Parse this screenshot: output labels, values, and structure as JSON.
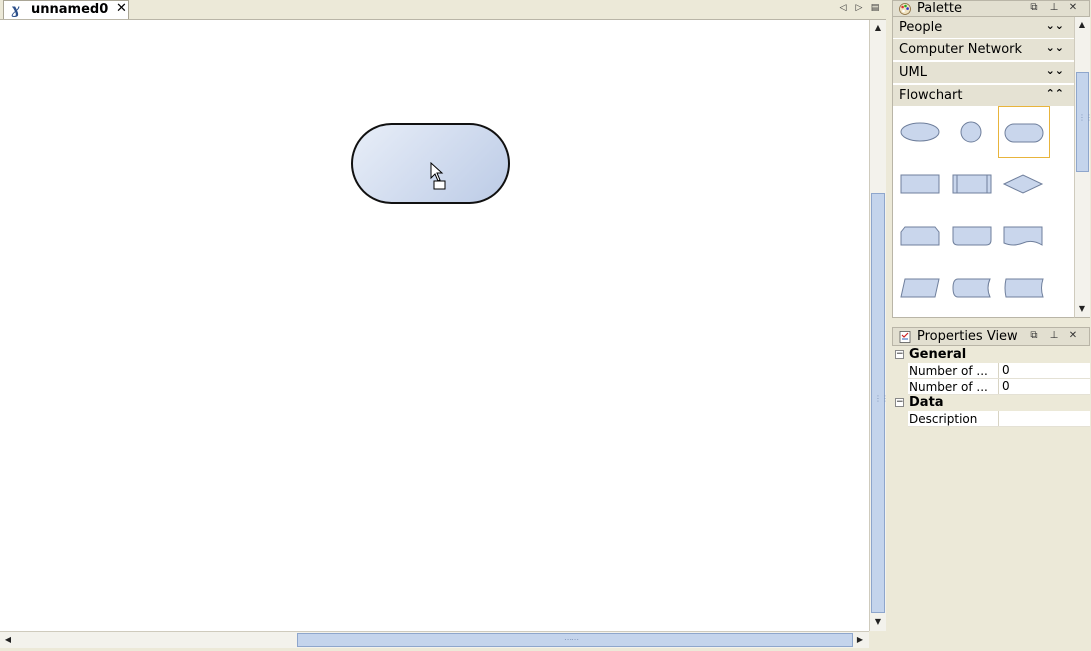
{
  "editor": {
    "tab_label": "unnamed0",
    "tab_close": "✕",
    "nav_prev": "◁",
    "nav_next": "▷",
    "nav_list": "▤"
  },
  "palette": {
    "title": "Palette",
    "categories": [
      {
        "label": "People",
        "chevron": "⌄⌄"
      },
      {
        "label": "Computer Network",
        "chevron": "⌄⌄"
      },
      {
        "label": "UML",
        "chevron": "⌄⌄"
      },
      {
        "label": "Flowchart",
        "chevron": "⌃⌃"
      }
    ],
    "selected_shape": "terminator"
  },
  "properties": {
    "title": "Properties View",
    "groups": [
      {
        "label": "General",
        "toggle": "−"
      },
      {
        "label": "Data",
        "toggle": "−"
      }
    ],
    "rows": [
      {
        "name": "Number of ...",
        "value": "0"
      },
      {
        "name": "Number of ...",
        "value": "0"
      },
      {
        "name": "Description",
        "value": ""
      }
    ]
  },
  "colors": {
    "shape_fill_start": "#e8eef8",
    "shape_fill_end": "#bccbe6",
    "selection": "#e8b43c"
  }
}
